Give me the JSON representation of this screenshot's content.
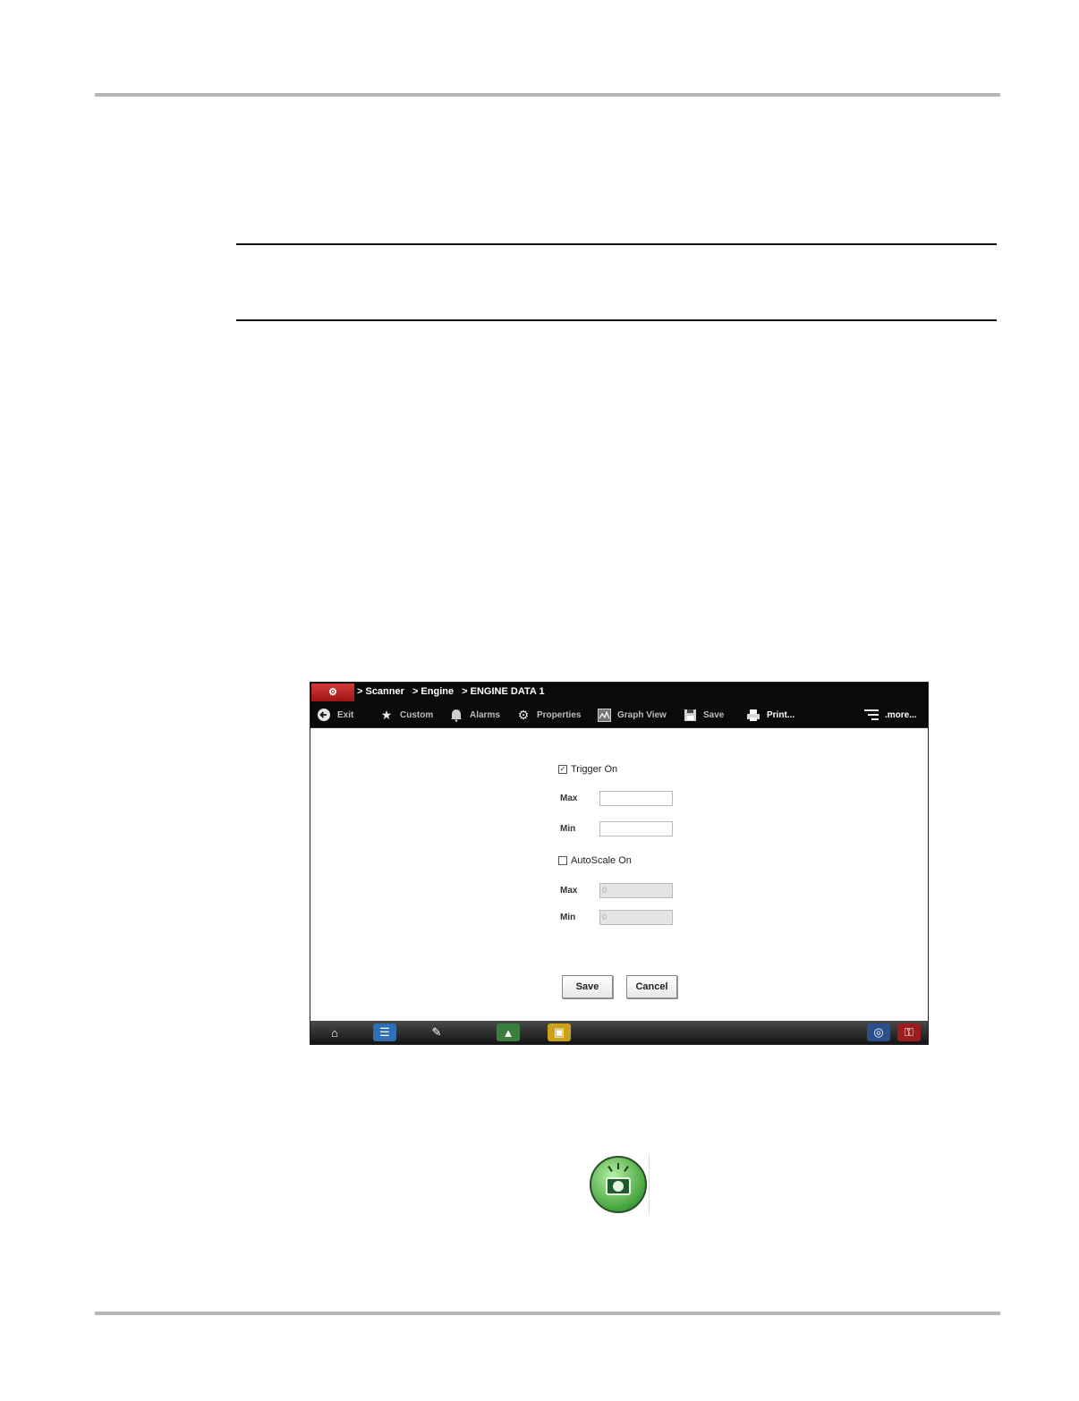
{
  "breadcrumb": [
    "> Scanner",
    "> Engine",
    "> ENGINE DATA 1"
  ],
  "toolbar": {
    "exit": "Exit",
    "custom": "Custom",
    "alarms": "Alarms",
    "properties": "Properties",
    "graph_view": "Graph View",
    "save": "Save",
    "print": "Print...",
    "more": ".more..."
  },
  "form": {
    "trigger_on": "Trigger On",
    "trigger_checked": true,
    "trigger_max_label": "Max",
    "trigger_max_value": "",
    "trigger_min_label": "Min",
    "trigger_min_value": "",
    "autoscale_on": "AutoScale On",
    "autoscale_checked": false,
    "autoscale_max_label": "Max",
    "autoscale_max_value": "0",
    "autoscale_min_label": "Min",
    "autoscale_min_value": "0",
    "save": "Save",
    "cancel": "Cancel"
  },
  "icons": {
    "toolbar": [
      "back-arrow-icon",
      "star-icon",
      "bell-icon",
      "gears-icon",
      "graph-icon",
      "floppy-icon",
      "printer-icon",
      "list-menu-icon"
    ],
    "taskbar": [
      "home-icon",
      "scanner-icon",
      "guided-component-test-icon",
      "scope-meter-icon",
      "data-manager-icon",
      "wifi-icon",
      "vehicle-connection-icon"
    ],
    "camera": "camera-capture-icon"
  },
  "colors": {
    "bar": "#0a0a0a",
    "logo": "#c62828",
    "camera_green": "#43a33a"
  }
}
